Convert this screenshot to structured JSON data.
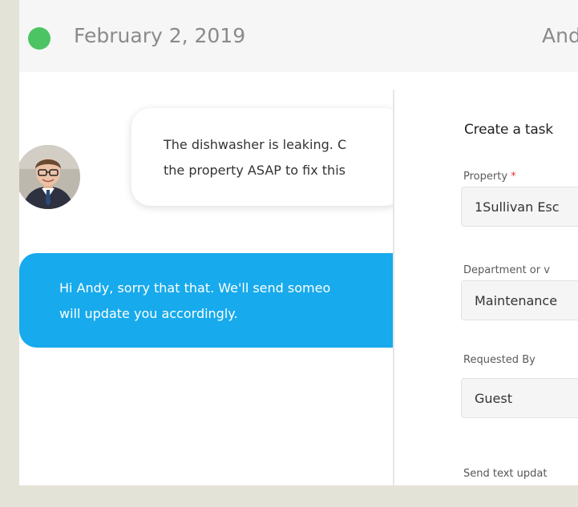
{
  "header": {
    "status_color": "#4cc463",
    "date": "February 2, 2019",
    "contact_name": "Andy"
  },
  "conversation": {
    "incoming": {
      "avatar_icon": "user-avatar-photo",
      "line1": "The dishwasher is leaking. C",
      "line2": "the property ASAP to fix this"
    },
    "outgoing": {
      "line1": "Hi Andy, sorry that that. We'll send someo",
      "line2": "will update you accordingly."
    }
  },
  "task_panel": {
    "title": "Create a task",
    "property_label": "Property",
    "required_mark": "*",
    "property_value": "1Sullivan Esc",
    "department_label": "Department or v",
    "department_value": "Maintenance",
    "requested_by_label": "Requested By",
    "requested_by_value": "Guest",
    "send_text_label": "Send text updat"
  },
  "colors": {
    "accent": "#17aaec",
    "required": "#e0392f",
    "status": "#4cc463"
  }
}
